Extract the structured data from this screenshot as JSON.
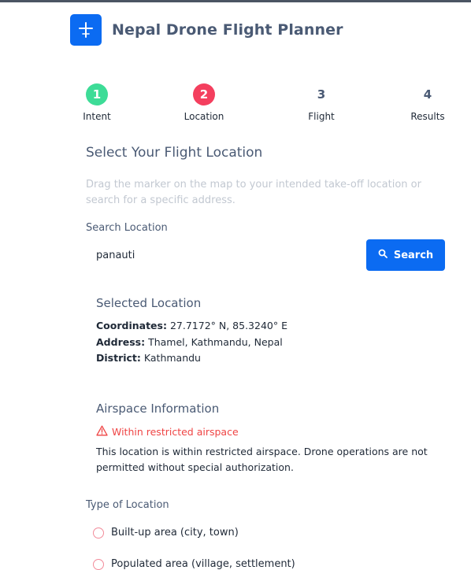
{
  "app": {
    "title": "Nepal Drone Flight Planner",
    "icon": "drone-plus-icon"
  },
  "colors": {
    "brand": "#0b6bf2",
    "step_done": "#3ddc97",
    "step_active": "#f43f5e",
    "warning": "#ef4444",
    "radio_border": "#f28b9a",
    "topbar": "#4b5563"
  },
  "steps": [
    {
      "number": "1",
      "label": "Intent",
      "state": "done"
    },
    {
      "number": "2",
      "label": "Location",
      "state": "active"
    },
    {
      "number": "3",
      "label": "Flight",
      "state": "pending"
    },
    {
      "number": "4",
      "label": "Results",
      "state": "pending"
    }
  ],
  "location": {
    "title": "Select Your Flight Location",
    "helper": "Drag the marker on the map to your intended take-off location or search for a specific address."
  },
  "search": {
    "label": "Search Location",
    "value": "panauti",
    "button_label": "Search",
    "button_icon": "search-icon"
  },
  "selected": {
    "title": "Selected Location",
    "coordinates_label": "Coordinates:",
    "coordinates_value": "27.7172° N, 85.3240° E",
    "address_label": "Address:",
    "address_value": "Thamel, Kathmandu, Nepal",
    "district_label": "District:",
    "district_value": "Kathmandu"
  },
  "airspace": {
    "title": "Airspace Information",
    "warning_icon": "warning-triangle-icon",
    "warning": "Within restricted airspace",
    "description": "This location is within restricted airspace. Drone operations are not permitted without special authorization."
  },
  "location_type": {
    "label": "Type of Location",
    "options": [
      "Built-up area (city, town)",
      "Populated area (village, settlement)"
    ]
  }
}
